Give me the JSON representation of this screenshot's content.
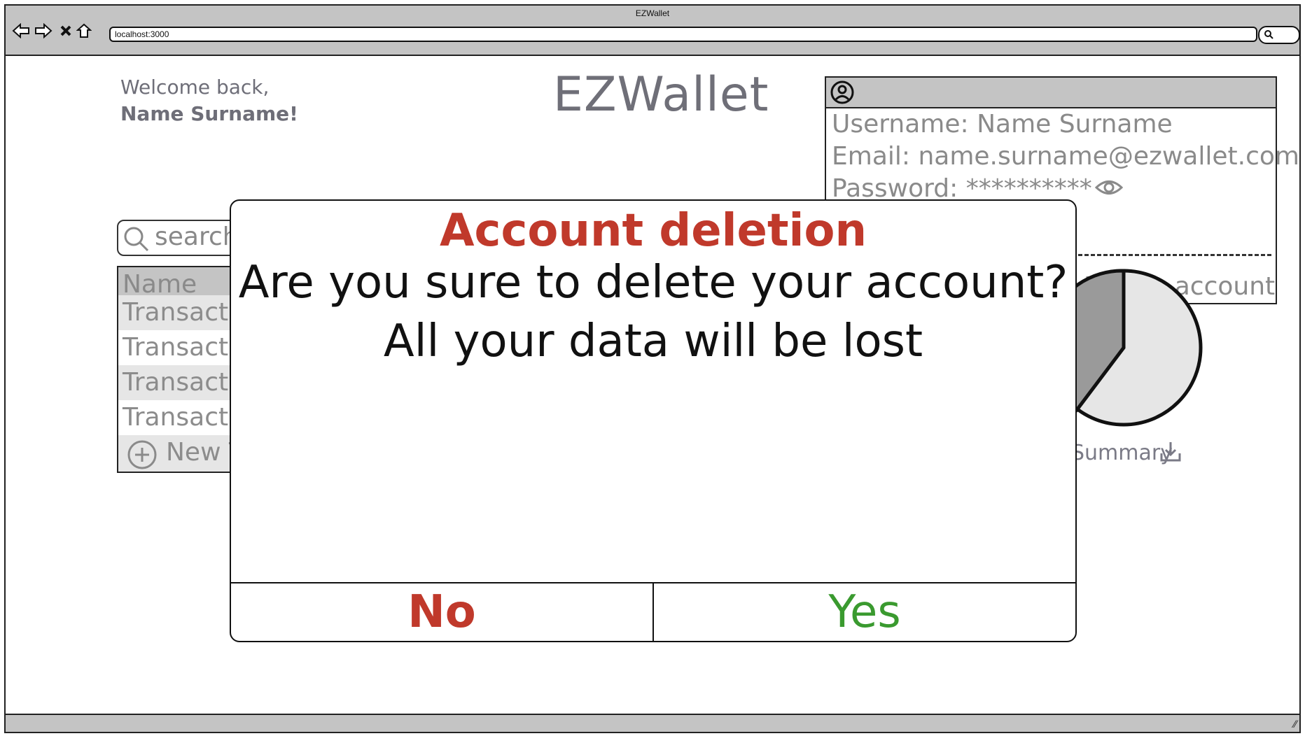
{
  "browser": {
    "window_title": "EZWallet",
    "url": "localhost:3000",
    "nav_icons": [
      "back-arrow-icon",
      "forward-arrow-icon",
      "close-icon",
      "home-icon"
    ]
  },
  "page": {
    "welcome_line1": "Welcome back,",
    "welcome_line2": "Name Surname!",
    "app_title": "EZWallet"
  },
  "account": {
    "username": "Username: Name Surname",
    "email": "Email: name.surname@ezwallet.com",
    "password": "Password: **********",
    "delete_label": "Delete account",
    "icon": "user-circle-icon"
  },
  "search": {
    "placeholder": "search"
  },
  "list": {
    "header": "Name",
    "rows": [
      "Transaction",
      "Transaction",
      "Transaction",
      "Transaction"
    ],
    "new_label": "New Transaction"
  },
  "summary": {
    "label": "Summary",
    "icon": "download-icon"
  },
  "modal": {
    "title": "Account deletion",
    "message_line1": "Are you sure to delete your account?",
    "message_line2": "All your data will be lost",
    "no_label": "No",
    "yes_label": "Yes"
  },
  "colors": {
    "danger": "#c0392b",
    "success": "#3a9a2f",
    "chrome": "#c4c4c4"
  }
}
